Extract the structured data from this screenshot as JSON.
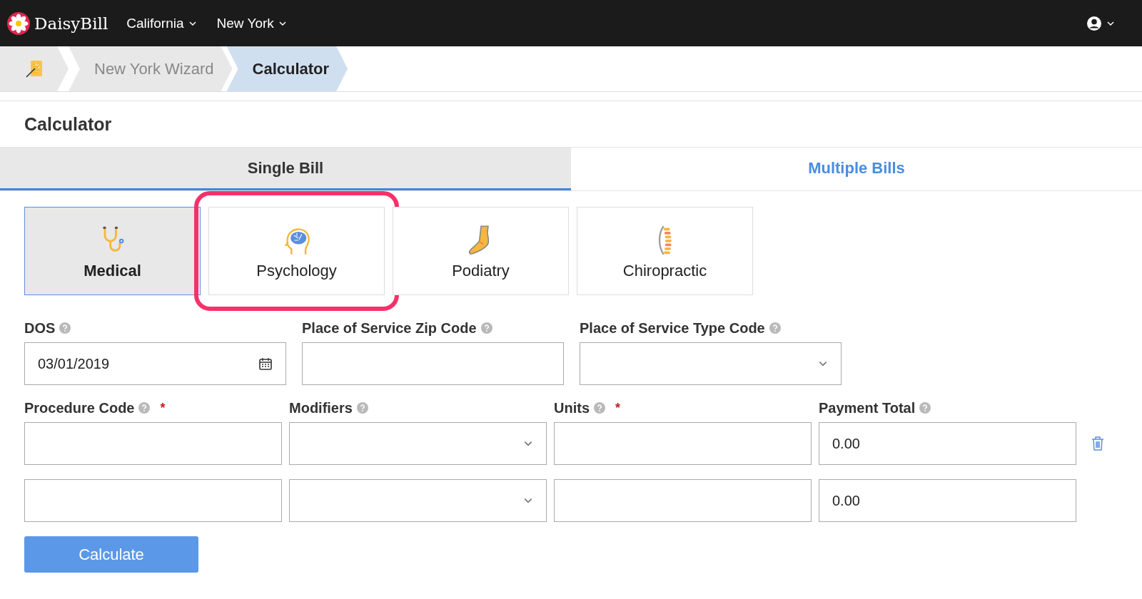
{
  "navbar": {
    "brand": "DaisyBill",
    "menus": [
      "California",
      "New York"
    ]
  },
  "breadcrumb": [
    {
      "label": "New York Wizard",
      "selected": false
    },
    {
      "label": "Calculator",
      "selected": true
    }
  ],
  "page_title": "Calculator",
  "tabs": [
    {
      "label": "Single Bill",
      "selected": true
    },
    {
      "label": "Multiple Bills",
      "selected": false
    }
  ],
  "specialties": [
    {
      "kind": "medical",
      "label": "Medical",
      "selected": true,
      "highlighted": false
    },
    {
      "kind": "psychology",
      "label": "Psychology",
      "selected": false,
      "highlighted": true
    },
    {
      "kind": "podiatry",
      "label": "Podiatry",
      "selected": false,
      "highlighted": false
    },
    {
      "kind": "chiropractic",
      "label": "Chiropractic",
      "selected": false,
      "highlighted": false
    }
  ],
  "service_fields": [
    {
      "kind": "date",
      "label": "DOS",
      "value": "03/01/2019"
    },
    {
      "kind": "text",
      "label": "Place of Service Zip Code"
    },
    {
      "kind": "select",
      "label": "Place of Service Type Code"
    }
  ],
  "line_columns": [
    {
      "kind": "text",
      "label": "Procedure Code",
      "required_mark": "*"
    },
    {
      "kind": "select",
      "label": "Modifiers"
    },
    {
      "kind": "text",
      "label": "Units",
      "required_mark": "*"
    },
    {
      "kind": "text",
      "label": "Payment Total"
    }
  ],
  "line_rows": [
    {
      "payment_total": "0.00",
      "deletable": true
    },
    {
      "payment_total": "0.00",
      "deletable": false
    }
  ],
  "calculate_button": "Calculate"
}
